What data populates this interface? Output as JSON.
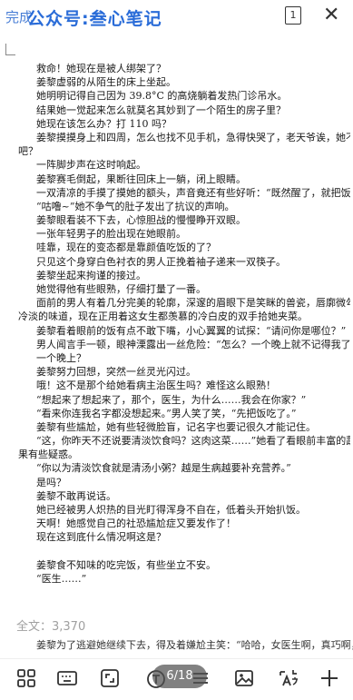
{
  "topbar": {
    "done_label": "完成",
    "watermark": "公众号:叁心笔记",
    "page_count_icon": "1",
    "close_glyph": "✕"
  },
  "document": {
    "lines": [
      {
        "text": "救命！她现在是被人绑架了？",
        "indent": true
      },
      {
        "text": "姜黎虚弱的从陌生的床上坐起。",
        "indent": true
      },
      {
        "text": "她明明记得自己因为 39.8°C 的高烧躺着发热门诊吊水。",
        "indent": true
      },
      {
        "text": "结果她一觉起来怎么就莫名其妙到了一个陌生的房子里？",
        "indent": true
      },
      {
        "text": "她现在该怎么办？打 110 吗？",
        "indent": true
      },
      {
        "text": "姜黎摸摸身上和四周，怎么也找不见手机，急得快哭了，老天爷诶，她不是遇上变态了",
        "indent": true
      },
      {
        "text": "吧？",
        "indent": false
      },
      {
        "text": "一阵脚步声在这时响起。",
        "indent": true
      },
      {
        "text": "姜黎赛毛倒起，果断往回床上一躺，闭上眼睛。",
        "indent": true
      },
      {
        "text": "一双清凉的手摸了摸她的额头，声音竟还有些好听：“既然醒了，就把饭吃了。”",
        "indent": true
      },
      {
        "text": "“咕噜~”她不争气的肚子发出了抗议的声响。",
        "indent": true
      },
      {
        "text": "姜黎眼看装不下去，心惊胆战的慢慢睁开双眼。",
        "indent": true
      },
      {
        "text": "一张年轻男子的脸出现在她眼前。",
        "indent": true
      },
      {
        "text": "哇靠，现在的变态都是靠颜值吃饭的了？",
        "indent": true
      },
      {
        "text": "只见这个身穿白色衬衣的男人正挽着袖子递来一双筷子。",
        "indent": true
      },
      {
        "text": "姜黎坐起来拘谨的接过。",
        "indent": true
      },
      {
        "text": "她觉得他有些眼熟，仔细打量了一番。",
        "indent": true
      },
      {
        "text": "面前的男人有着几分完美的轮廓，深邃的眉眼下是笑眯的兽瓷，唇廓微勾，却带着几分",
        "indent": true
      },
      {
        "text": "冷淡的味道，现在正用着这女生都羡慕的冷白皮的双手拾她夹菜。",
        "indent": false
      },
      {
        "text": "姜黎看着眼前的饭有点不敢下嘴，小心翼翼的试探：“请问你是哪位？”",
        "indent": true
      },
      {
        "text": "男人闻言手一顿，眼神溧露出一丝危险：“怎么？一个晚上就不记得我了？”",
        "indent": true
      },
      {
        "text": "一个晚上？",
        "indent": true
      },
      {
        "text": "姜黎努力回想，突然一丝灵光闪过。",
        "indent": true
      },
      {
        "text": "哦！这不是那个给她看病主治医生吗？难怪这么眼熟！",
        "indent": true
      },
      {
        "text": "“想起来了想起来了，那个，医生，为什么……我会在你家？”",
        "indent": true
      },
      {
        "text": "“看来你连我名字都没想起来。”男人笑了笑，“先把饭吃了。”",
        "indent": true
      },
      {
        "text": "姜黎有些尴尬，她有些轻微脸盲，记名字也要记很久才能记住。",
        "indent": true
      },
      {
        "text": "“这，你昨天不还说要清淡饮食吗？这肉这菜……”她看了看眼前丰富的蔬菜、鸡肉，",
        "indent": true
      },
      {
        "text": "果有些疑惑。",
        "indent": false
      },
      {
        "text": "“你以为清淡饮食就是清汤小粥？越是生病越要补充营养。”",
        "indent": true
      },
      {
        "text": "是吗？",
        "indent": true
      },
      {
        "text": "姜黎不敢再说话。",
        "indent": true
      },
      {
        "text": "她已经被男人炽热的目光盯得浑身不自在，低着头开始扒饭。",
        "indent": true
      },
      {
        "text": "天啊！她感觉自己的社恐尴尬症又要发作了！",
        "indent": true
      },
      {
        "text": "现在这到底什么情况啊这是？",
        "indent": true
      },
      {
        "text": "",
        "indent": false
      },
      {
        "text": "姜黎食不知味的吃完饭，有些坐立不安。",
        "indent": true
      },
      {
        "text": "“医生……”",
        "indent": true
      }
    ],
    "peek_line": "姜黎为了逃避她继续下去，得及着嫌尬主笑：“哈哈，女医生啊，真巧啊，我以前一"
  },
  "word_count": "全文：3,370",
  "page_indicator": "6/18",
  "toolbar": {
    "items": [
      "grid-icon",
      "keyboard-icon",
      "expand-icon",
      "text-format-icon",
      "list-icon",
      "image-icon",
      "translate-icon",
      "add-icon"
    ]
  }
}
